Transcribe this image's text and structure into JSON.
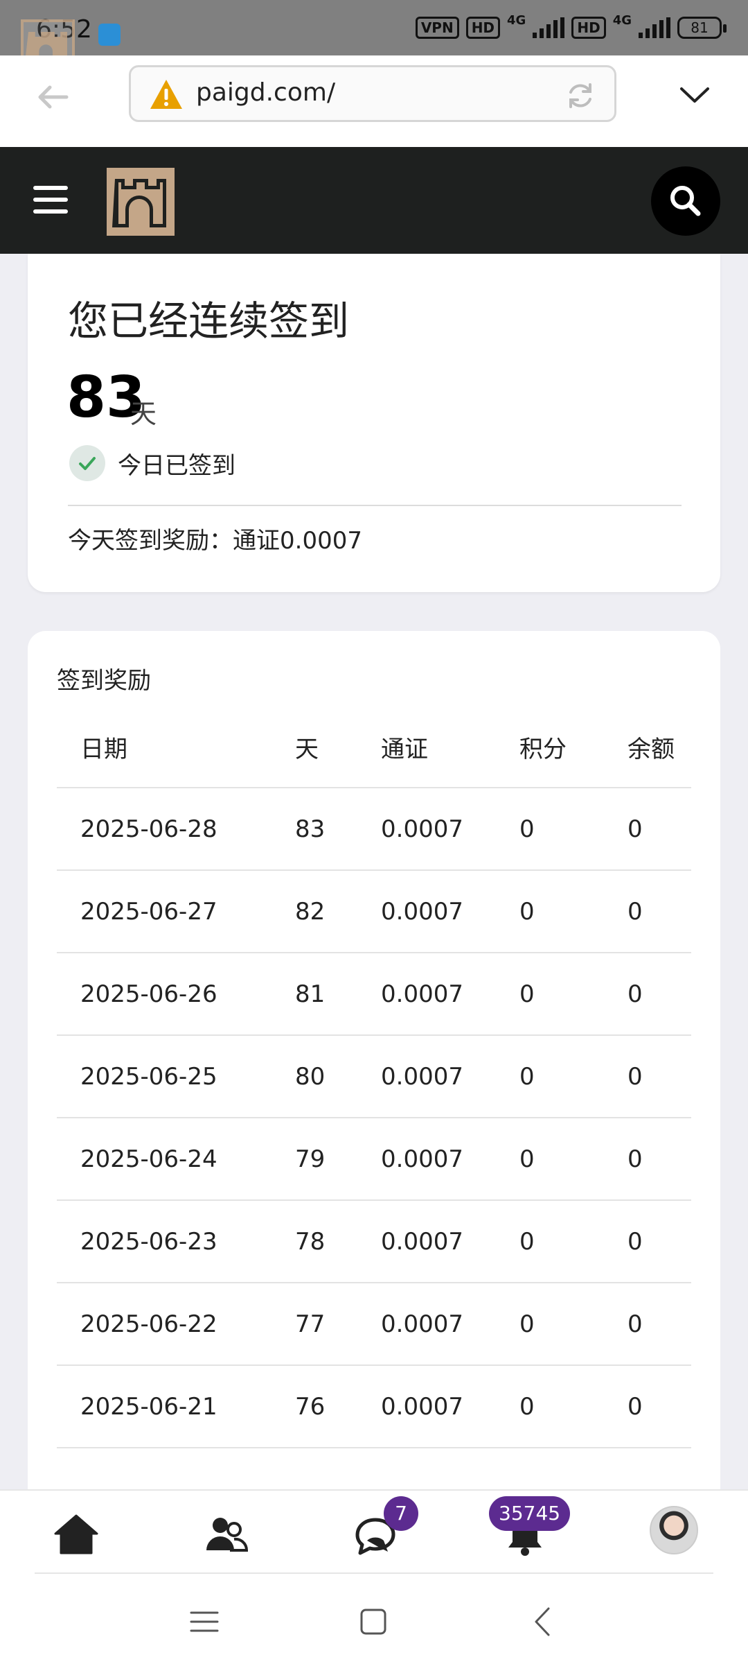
{
  "status_bar": {
    "time": "6:52",
    "vpn": "VPN",
    "hd": "HD",
    "net": "4G",
    "battery": "81"
  },
  "browser": {
    "url": "paigd.com/"
  },
  "streak": {
    "title": "您已经连续签到",
    "days": "83",
    "unit": "天",
    "checked_label": "今日已签到",
    "reward_today": "今天签到奖励：通证0.0007"
  },
  "rewards": {
    "title": "签到奖励",
    "columns": [
      "日期",
      "天",
      "通证",
      "积分",
      "余额"
    ],
    "rows": [
      [
        "2025-06-28",
        "83",
        "0.0007",
        "0",
        "0"
      ],
      [
        "2025-06-27",
        "82",
        "0.0007",
        "0",
        "0"
      ],
      [
        "2025-06-26",
        "81",
        "0.0007",
        "0",
        "0"
      ],
      [
        "2025-06-25",
        "80",
        "0.0007",
        "0",
        "0"
      ],
      [
        "2025-06-24",
        "79",
        "0.0007",
        "0",
        "0"
      ],
      [
        "2025-06-23",
        "78",
        "0.0007",
        "0",
        "0"
      ],
      [
        "2025-06-22",
        "77",
        "0.0007",
        "0",
        "0"
      ],
      [
        "2025-06-21",
        "76",
        "0.0007",
        "0",
        "0"
      ]
    ]
  },
  "bottom_nav": {
    "items": [
      "home-icon",
      "people-icon",
      "chat-icon",
      "bell-icon",
      "avatar"
    ],
    "chat_badge": "7",
    "bell_badge": "35745"
  },
  "colors": {
    "header_bg": "#1e201f",
    "logo_brown": "#c4a688",
    "badge_purple": "#5c2b90",
    "check_green": "#3aa65a",
    "warning": "#e8a000"
  }
}
